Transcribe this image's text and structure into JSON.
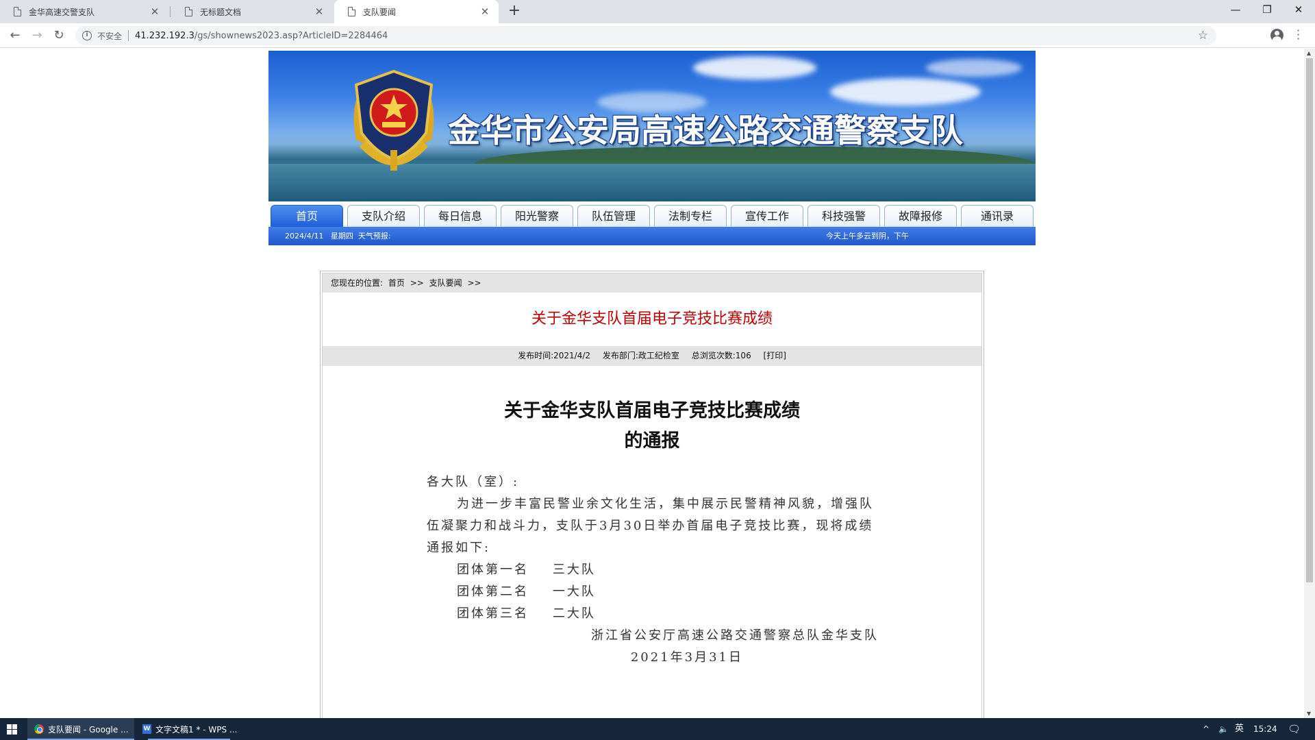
{
  "browser": {
    "tabs": [
      {
        "title": "金华高速交警支队",
        "active": false
      },
      {
        "title": "无标题文档",
        "active": false
      },
      {
        "title": "支队要闻",
        "active": true
      }
    ],
    "security_label": "不安全",
    "url_host": "41.232.192.3",
    "url_path": "/gs/shownews2023.asp?ArticleID=2284464"
  },
  "site": {
    "banner_title": "金华市公安局高速公路交通警察支队",
    "nav": [
      "首页",
      "支队介绍",
      "每日信息",
      "阳光警察",
      "队伍管理",
      "法制专栏",
      "宣传工作",
      "科技强警",
      "故障报修",
      "通讯录"
    ],
    "info_date": "2024/4/11   星期四  天气预报:",
    "info_weather": "今天上午多云到阴，下午"
  },
  "article": {
    "crumb_label": "您现在的位置:",
    "crumb_home": "首页",
    "crumb_sep": ">>",
    "crumb_section": "支队要闻",
    "headline": "关于金华支队首届电子竞技比赛成绩",
    "meta_time": "发布时间:2021/4/2",
    "meta_dept": "发布部门:政工纪检室",
    "meta_views": "总浏览次数:106",
    "meta_print": "[打印]",
    "doc_title_line1": "关于金华支队首届电子竞技比赛成绩",
    "doc_title_line2": "的通报",
    "salutation": "各大队（室）:",
    "paragraph": "为进一步丰富民警业余文化生活，集中展示民警精神风貌，增强队伍凝聚力和战斗力，支队于3月30日举办首届电子竞技比赛，现将成绩通报如下:",
    "ranks": [
      {
        "place": "团体第一名",
        "team": "三大队"
      },
      {
        "place": "团体第二名",
        "team": "一大队"
      },
      {
        "place": "团体第三名",
        "team": "二大队"
      }
    ],
    "signature": "浙江省公安厅高速公路交通警察总队金华支队",
    "date": "2021年3月31日"
  },
  "taskbar": {
    "tasks": [
      {
        "label": "支队要闻 - Google ..."
      },
      {
        "label": "文字文稿1 * - WPS ..."
      }
    ],
    "ime": "英",
    "time": "15:24"
  }
}
